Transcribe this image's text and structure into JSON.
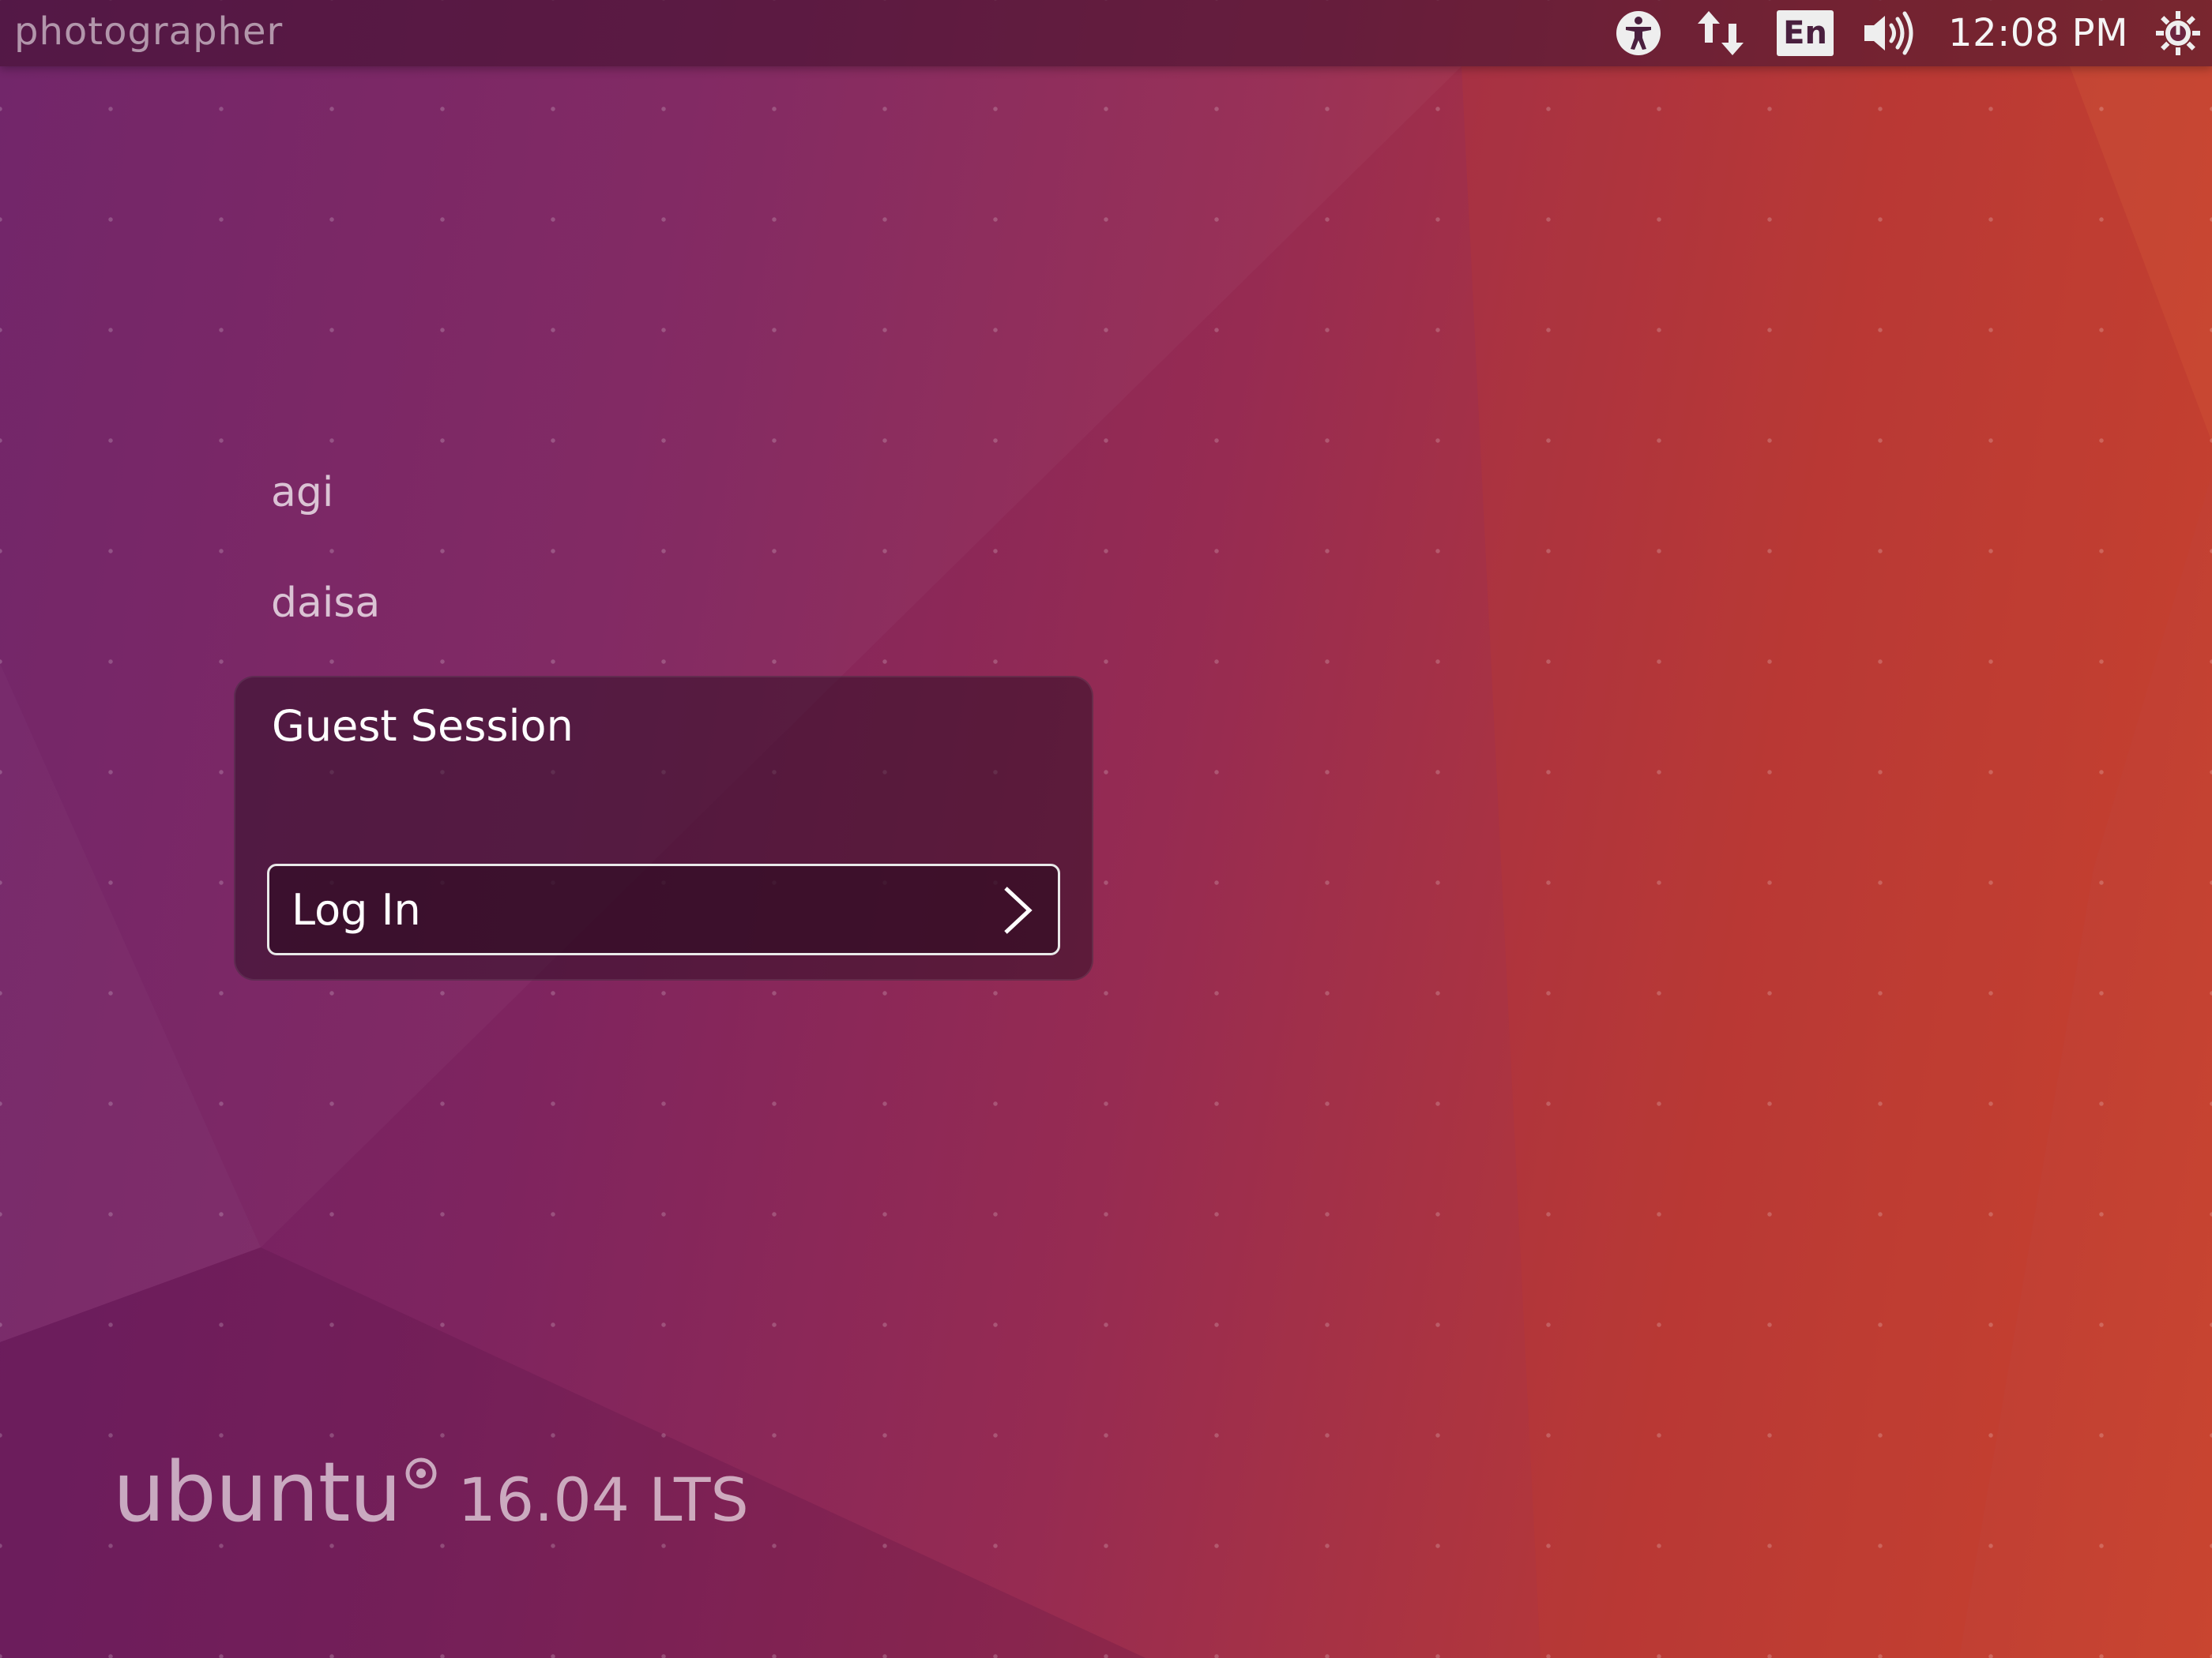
{
  "top_panel": {
    "hostname": "photographer",
    "icons": [
      "accessibility-icon",
      "network-icon",
      "keyboard-layout-icon",
      "volume-icon",
      "power-icon"
    ],
    "keyboard_layout": "En",
    "clock": "12:08 PM"
  },
  "users": [
    {
      "name": "agi"
    },
    {
      "name": "daisa"
    }
  ],
  "greeter": {
    "session_title": "Guest Session",
    "login_label": "Log In"
  },
  "branding": {
    "word": "ubuntu",
    "version": "16.04 LTS"
  },
  "colors": {
    "bg_left": "#6e1f66",
    "bg_right": "#c94530",
    "text": "#ffffff"
  }
}
